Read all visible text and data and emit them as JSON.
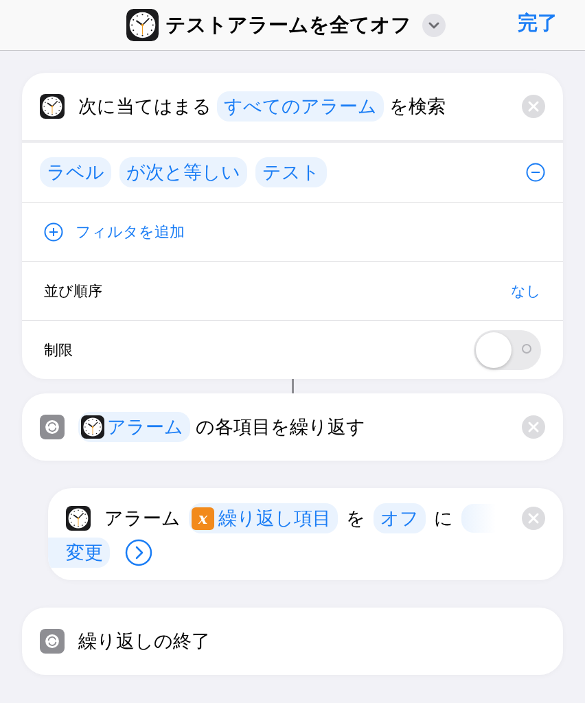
{
  "header": {
    "title": "テストアラームを全てオフ",
    "done": "完了"
  },
  "find_action": {
    "prefix": "次に当てはまる",
    "token": "すべてのアラーム",
    "suffix": "を検索",
    "filters": [
      {
        "tokens": [
          "ラベル",
          "が次と等しい",
          "テスト"
        ]
      }
    ],
    "add_filter": "フィルタを追加",
    "sort": {
      "label": "並び順序",
      "value": "なし"
    },
    "limit": {
      "label": "制限",
      "on": false
    }
  },
  "repeat_action": {
    "token": "アラーム",
    "text": "の各項目を繰り返す"
  },
  "set_action": {
    "lines": [
      [
        {
          "kind": "text",
          "text": "アラーム"
        },
        {
          "kind": "variable",
          "icon": "x",
          "text": "繰り返し項目"
        },
        {
          "kind": "text",
          "text": "を"
        },
        {
          "kind": "token",
          "text": "オフ"
        },
        {
          "kind": "text",
          "text": "に"
        },
        {
          "kind": "empty"
        }
      ],
      [
        {
          "kind": "token",
          "text": "変更"
        }
      ]
    ]
  },
  "end_repeat": {
    "text": "繰り返しの終了"
  }
}
